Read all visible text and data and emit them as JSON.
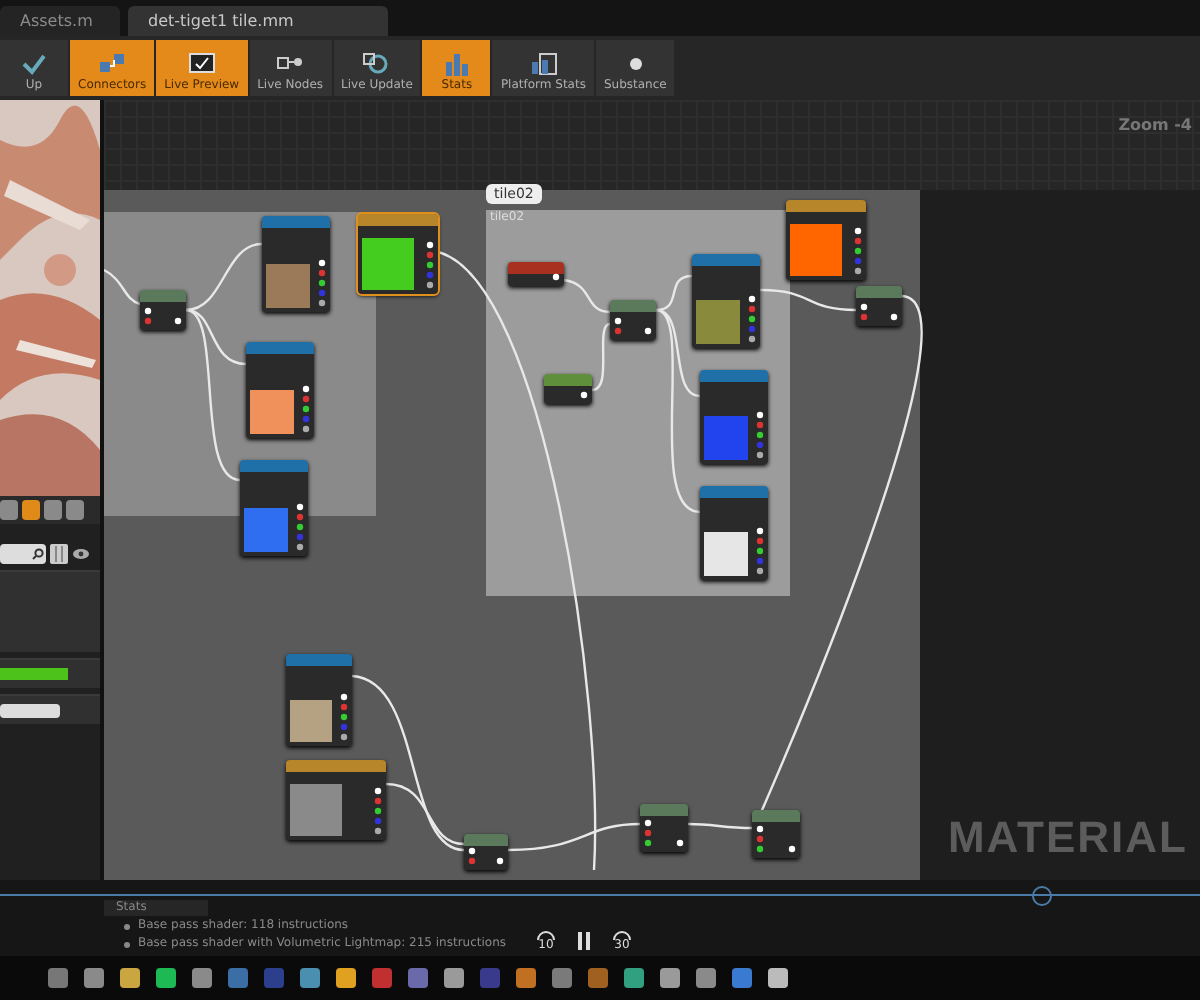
{
  "tabs": [
    {
      "label": "Assets.m",
      "selected": false
    },
    {
      "label": "det-tiget1 tile.mm",
      "selected": true
    }
  ],
  "toolbar": [
    {
      "label": "Up",
      "selected": false
    },
    {
      "label": "Connectors",
      "selected": true
    },
    {
      "label": "Live Preview",
      "selected": true
    },
    {
      "label": "Live Nodes",
      "selected": false
    },
    {
      "label": "Live Update",
      "selected": false
    },
    {
      "label": "Stats",
      "selected": true
    },
    {
      "label": "Platform Stats",
      "selected": false
    },
    {
      "label": "Substance",
      "selected": false
    }
  ],
  "viewport_buttons": [
    {
      "selected": false
    },
    {
      "selected": true
    },
    {
      "selected": false
    },
    {
      "selected": false
    }
  ],
  "graph": {
    "zoom": "Zoom -4",
    "watermark": "MATERIAL",
    "comments": [
      {
        "title": "tile02",
        "bubble": "tile02"
      }
    ],
    "nodes": [
      {
        "kind": "math"
      },
      {
        "kind": "texture",
        "color": "#9a7a58"
      },
      {
        "kind": "param",
        "color": "#44cc1e"
      },
      {
        "kind": "texture",
        "color": "#f0905a"
      },
      {
        "kind": "texture",
        "color": "#2f6ef0"
      },
      {
        "kind": "input"
      },
      {
        "kind": "math"
      },
      {
        "kind": "constant"
      },
      {
        "kind": "texture",
        "color": "#8a8a3c"
      },
      {
        "kind": "texture",
        "color": "#2244ee"
      },
      {
        "kind": "texture",
        "color": "#e6e6e6"
      },
      {
        "kind": "param",
        "color": "#ff6600"
      },
      {
        "kind": "math"
      },
      {
        "kind": "texture",
        "color": "#b4a282"
      },
      {
        "kind": "param",
        "color": "#8a8a8a"
      },
      {
        "kind": "math"
      },
      {
        "kind": "lerp"
      },
      {
        "kind": "lerp"
      }
    ]
  },
  "stats": {
    "tab": "Stats",
    "lines": [
      "Base pass shader: 118 instructions",
      "Base pass shader with Volumetric Lightmap: 215 instructions"
    ]
  },
  "player": {
    "level": 0.868,
    "back": "10",
    "forward": "30",
    "playing": true
  },
  "taskbar": [
    {
      "color": "#777777"
    },
    {
      "color": "#8a8a8a"
    },
    {
      "color": "#c9a640"
    },
    {
      "color": "#1db954"
    },
    {
      "color": "#8a8a8a"
    },
    {
      "color": "#3b6ea5"
    },
    {
      "color": "#2b3f8c"
    },
    {
      "color": "#4a8fb0"
    },
    {
      "color": "#e0a020"
    },
    {
      "color": "#c03030"
    },
    {
      "color": "#6a6aaa"
    },
    {
      "color": "#9a9a9a"
    },
    {
      "color": "#3a3a8c"
    },
    {
      "color": "#c07020"
    },
    {
      "color": "#7a7a7a"
    },
    {
      "color": "#a06020"
    },
    {
      "color": "#30a080"
    },
    {
      "color": "#9a9a9a"
    },
    {
      "color": "#8a8a8a"
    },
    {
      "color": "#3a7ad0"
    },
    {
      "color": "#bbbbbb"
    }
  ]
}
